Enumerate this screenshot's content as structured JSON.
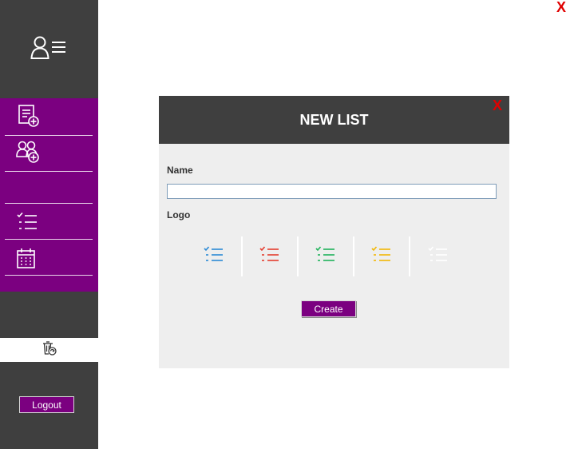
{
  "app": {
    "close_label": "X"
  },
  "sidebar": {
    "profile_icon": "user-list-icon",
    "items": [
      {
        "icon": "new-list-icon"
      },
      {
        "icon": "add-group-icon"
      },
      {
        "icon": "empty"
      },
      {
        "icon": "checklist-icon"
      },
      {
        "icon": "calendar-icon"
      }
    ],
    "trash_icon": "recycle-bin-icon",
    "logout_label": "Logout"
  },
  "modal": {
    "title": "NEW LIST",
    "close_label": "X",
    "name_label": "Name",
    "name_value": "",
    "logo_label": "Logo",
    "logo_options": [
      {
        "icon": "checklist-icon",
        "color": "#2b8ad6"
      },
      {
        "icon": "checklist-icon",
        "color": "#e53c2e"
      },
      {
        "icon": "checklist-icon",
        "color": "#1fb35a"
      },
      {
        "icon": "checklist-icon",
        "color": "#f2b705"
      },
      {
        "icon": "checklist-icon",
        "color": "#ffffff"
      }
    ],
    "create_label": "Create"
  },
  "colors": {
    "accent": "#7b0080",
    "sidebar_bg": "#3f3f3f",
    "modal_bg": "#eeeeee",
    "close_red": "#e00000"
  }
}
